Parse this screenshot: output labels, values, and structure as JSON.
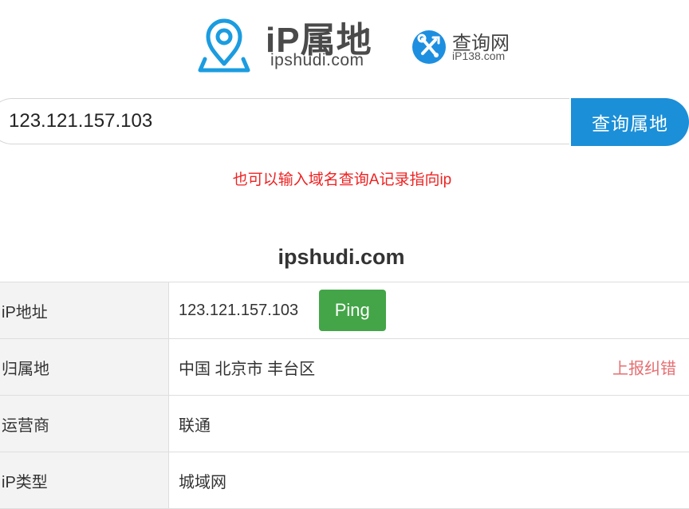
{
  "brand": {
    "title_ip": "iP",
    "title_rest": "属地",
    "subtitle": "ipshudi.com"
  },
  "partner": {
    "title": "查询网",
    "subtitle": "iP138.com"
  },
  "search": {
    "value": "123.121.157.103",
    "button_label": "查询属地"
  },
  "hint": "也可以输入域名查询A记录指向ip",
  "site_title": "ipshudi.com",
  "rows": [
    {
      "label": "iP地址",
      "value": "123.121.157.103",
      "action": "Ping"
    },
    {
      "label": "归属地",
      "value": "中国 北京市 丰台区",
      "action": "上报纠错"
    },
    {
      "label": "运营商",
      "value": "联通"
    },
    {
      "label": "iP类型",
      "value": "城域网"
    }
  ],
  "colors": {
    "brand_blue": "#1b8fd8",
    "hint_red": "#ee2222",
    "ping_green": "#43a547",
    "report_red": "#e56f72",
    "label_bg": "#f3f3f3"
  },
  "icons": {
    "brand": "location-pin-icon",
    "partner": "wrench-screwdriver-icon"
  }
}
